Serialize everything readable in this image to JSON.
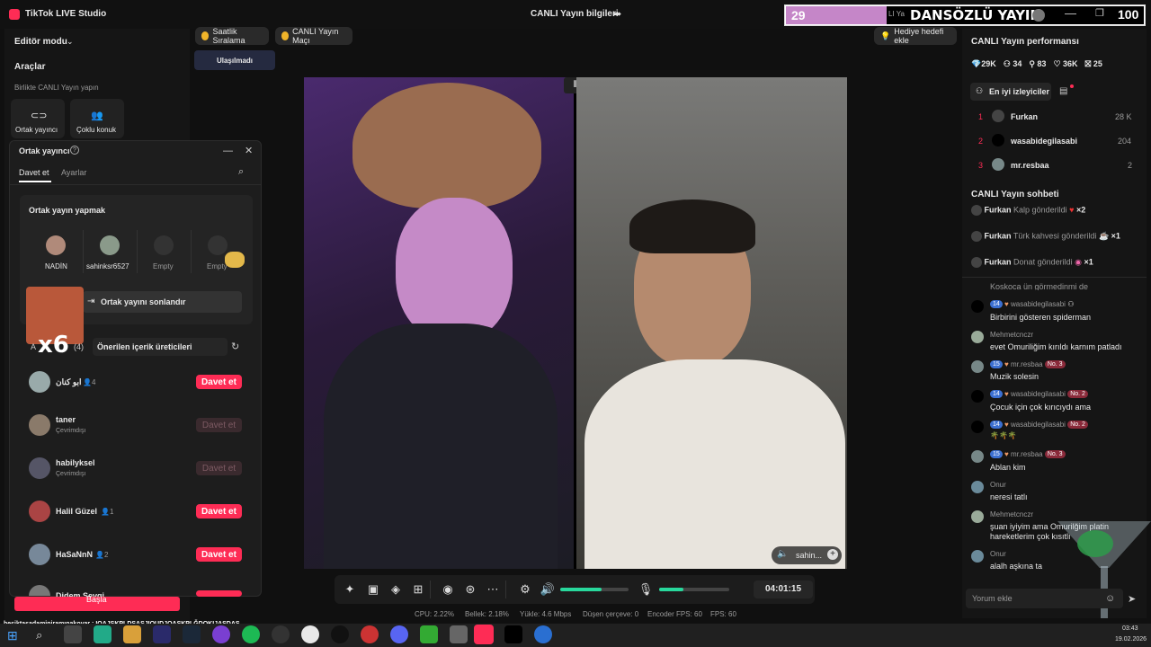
{
  "app": {
    "title": "TikTok LIVE Studio",
    "center_title": "CANLI Yayın bilgileri"
  },
  "overlay": {
    "left_num": "29",
    "banner": "DANSÖZLÜ YAYIN",
    "banner_small": "LI Ya",
    "right_num": "100",
    "sticker": "x6"
  },
  "left": {
    "mode": "Editör modu",
    "tools_title": "Araçlar",
    "collab_label": "Birlikte CANLI Yayın yapın",
    "btn_cohost": "Ortak yayıncı",
    "btn_multi": "Çoklu konuk"
  },
  "cohost_panel": {
    "title": "Ortak yayıncı",
    "tab_invite": "Davet et",
    "tab_settings": "Ayarlar",
    "section": "Ortak yayın yapmak",
    "slots": [
      {
        "name": "NADİN"
      },
      {
        "name": "sahinksr6527"
      },
      {
        "name": "Empty"
      },
      {
        "name": "Empty"
      }
    ],
    "end_button": "Ortak yayını sonlandır",
    "list_prefix": "A",
    "list_count": "(4)",
    "suggest": "Önerilen içerik üreticileri",
    "users": [
      {
        "name": "ابو كنان",
        "count": "4",
        "sub": "",
        "btn": "Davet et",
        "active": true
      },
      {
        "name": "taner",
        "count": "",
        "sub": "Çevrimdışı",
        "btn": "Davet et",
        "active": false
      },
      {
        "name": "habilyksel",
        "count": "",
        "sub": "Çevrimdışı",
        "btn": "Davet et",
        "active": false
      },
      {
        "name": "Halil Güzel",
        "count": "1",
        "sub": "",
        "btn": "Davet et",
        "active": true
      },
      {
        "name": "HaSaNnN",
        "count": "2",
        "sub": "",
        "btn": "Davet et",
        "active": true
      },
      {
        "name": "Didem Sevgi",
        "count": "1",
        "sub": "",
        "btn": "Davet et",
        "active": true
      }
    ]
  },
  "top_pills": {
    "hourly": "Saatlik Sıralama",
    "match": "CANLI Yayın Maçı",
    "unreached": "Ulaşılmadı",
    "gift_goal": "Hediye hedefi ekle"
  },
  "video": {
    "right_user": "sahin..."
  },
  "controls": {
    "time": "04:01:15",
    "mic_level": 0.35,
    "vol_level": 0.6
  },
  "stats": {
    "cpu": "CPU: 2.22%",
    "mem": "Bellek: 2.18%",
    "upload": "Yükle: 4.6 Mbps",
    "dropped": "Düşen çerçeve: 0",
    "enc_fps": "Encoder FPS: 60",
    "fps": "FPS: 60"
  },
  "right": {
    "perf_title": "CANLI Yayın performansı",
    "metrics": [
      {
        "icon": "diamond-icon",
        "value": "29K"
      },
      {
        "icon": "users-icon",
        "value": "34"
      },
      {
        "icon": "person-plus-icon",
        "value": "83"
      },
      {
        "icon": "heart-icon",
        "value": "36K"
      },
      {
        "icon": "gift-icon",
        "value": "25"
      }
    ],
    "top_viewers_tab": "En iyi izleyiciler",
    "ranking": [
      {
        "rank": "1",
        "name": "Furkan",
        "score": "28 K"
      },
      {
        "rank": "2",
        "name": "wasabidegilasabi",
        "score": "204"
      },
      {
        "rank": "3",
        "name": "mr.resbaa",
        "score": "2"
      }
    ],
    "chat_title": "CANLI Yayın sohbeti",
    "gifts": [
      {
        "user": "Furkan",
        "action": "Kalp gönderildi",
        "mult": "×2"
      },
      {
        "user": "Furkan",
        "action": "Türk kahvesi gönderildi",
        "mult": "×1"
      },
      {
        "user": "Furkan",
        "action": "Donat gönderildi",
        "mult": "×1"
      }
    ],
    "partial_msg": "Koskoca ün görmedinmi de",
    "messages": [
      {
        "lvl": "14",
        "user": "wasabidegilasabi",
        "rankb": "",
        "text": "Birbirini gösteren spiderman"
      },
      {
        "lvl": "",
        "user": "Mehmetcnczr",
        "rankb": "",
        "text": "evet Omuriliğim kırıldı karnım patladı"
      },
      {
        "lvl": "15",
        "user": "mr.resbaa",
        "rankb": "No. 3",
        "text": "Muzik solesin"
      },
      {
        "lvl": "14",
        "user": "wasabidegilasabi",
        "rankb": "No. 2",
        "text": "Çocuk için çok kırıcıydı ama"
      },
      {
        "lvl": "14",
        "user": "wasabidegilasabi",
        "rankb": "No. 2",
        "text": "🌴🌴🌴"
      },
      {
        "lvl": "15",
        "user": "mr.resbaa",
        "rankb": "No. 3",
        "text": "Ablan kim"
      },
      {
        "lvl": "",
        "user": "Onur",
        "rankb": "",
        "text": "neresi tatlı"
      },
      {
        "lvl": "",
        "user": "Mehmetcnczr",
        "rankb": "",
        "text": "şuan iyiyim ama Omurilğim platin hareketlerim çok kısıtlı"
      },
      {
        "lvl": "",
        "user": "Onur",
        "rankb": "",
        "text": "alalh aşkına ta"
      }
    ],
    "comment_placeholder": "Yorum ekle"
  },
  "bottom": {
    "start_label": "Başla",
    "ticker": "besiktasadaminiramınakoyar : IOAJSKPLDŞASJIOUDJOASKPLĞDOKIJASDAS"
  },
  "taskbar": {
    "time": "03:43",
    "date": "19.02.2026"
  },
  "colors": {
    "accent": "#fe2c55",
    "bg": "#101010",
    "panel": "#1b1b1b"
  }
}
